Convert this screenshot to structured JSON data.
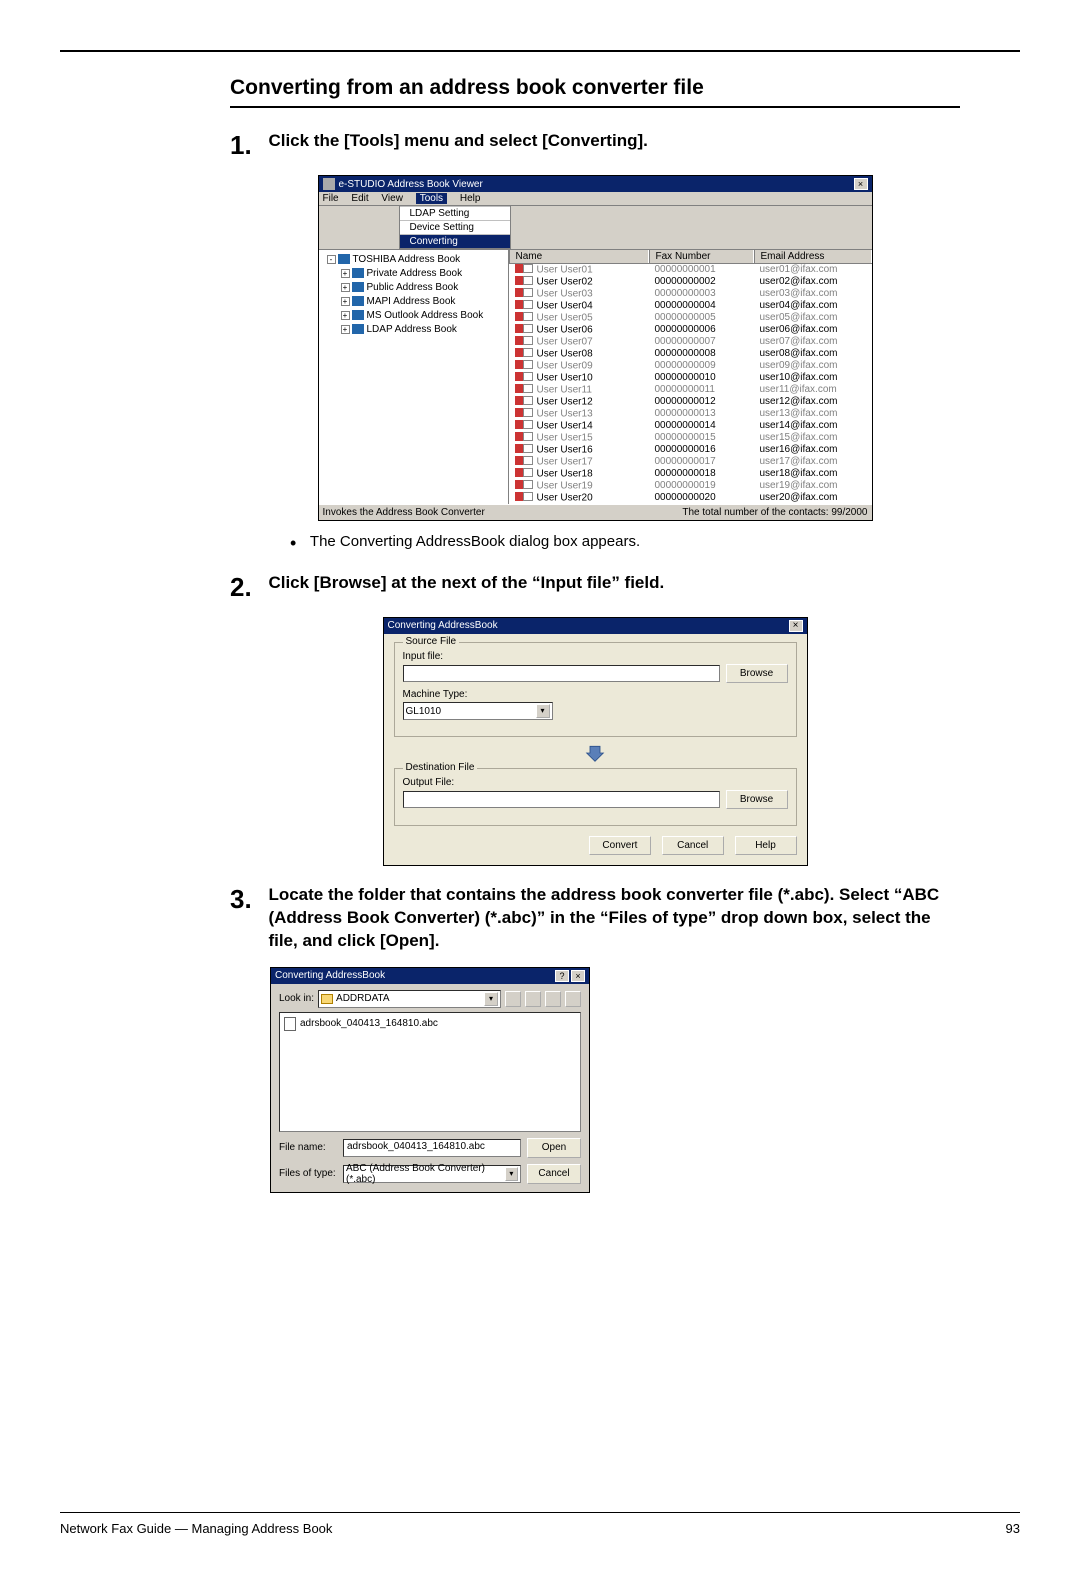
{
  "section_title": "Converting from an address book converter file",
  "steps": {
    "s1": {
      "num": "1.",
      "text": "Click the [Tools] menu and select [Converting]."
    },
    "s1_bullet": "The Converting AddressBook dialog box appears.",
    "s2": {
      "num": "2.",
      "text": "Click [Browse] at the next of the “Input file” field."
    },
    "s3": {
      "num": "3.",
      "text": "Locate the folder that contains the address book converter file (*.abc).  Select “ABC (Address Book Converter) (*.abc)” in the “Files of type” drop down box, select the file, and click [Open]."
    }
  },
  "shot1": {
    "title": "e-STUDIO Address Book Viewer",
    "close": "×",
    "menubar": {
      "file": "File",
      "edit": "Edit",
      "view": "View",
      "tools": "Tools",
      "help": "Help"
    },
    "tools_menu": {
      "ldap": "LDAP Setting",
      "device": "Device Setting",
      "converting": "Converting"
    },
    "tree": {
      "root": "TOSHIBA Address Book",
      "items": [
        "Private Address Book",
        "Public Address Book",
        "MAPI Address Book",
        "MS Outlook Address Book",
        "LDAP Address Book"
      ]
    },
    "headers": {
      "name": "Name",
      "fax": "Fax Number",
      "email": "Email Address"
    },
    "rows": [
      {
        "n": "User User01",
        "f": "00000000001",
        "e": "user01@ifax.com",
        "g": true
      },
      {
        "n": "User User02",
        "f": "00000000002",
        "e": "user02@ifax.com",
        "g": false
      },
      {
        "n": "User User03",
        "f": "00000000003",
        "e": "user03@ifax.com",
        "g": true
      },
      {
        "n": "User User04",
        "f": "00000000004",
        "e": "user04@ifax.com",
        "g": false
      },
      {
        "n": "User User05",
        "f": "00000000005",
        "e": "user05@ifax.com",
        "g": true
      },
      {
        "n": "User User06",
        "f": "00000000006",
        "e": "user06@ifax.com",
        "g": false
      },
      {
        "n": "User User07",
        "f": "00000000007",
        "e": "user07@ifax.com",
        "g": true
      },
      {
        "n": "User User08",
        "f": "00000000008",
        "e": "user08@ifax.com",
        "g": false
      },
      {
        "n": "User User09",
        "f": "00000000009",
        "e": "user09@ifax.com",
        "g": true
      },
      {
        "n": "User User10",
        "f": "00000000010",
        "e": "user10@ifax.com",
        "g": false
      },
      {
        "n": "User User11",
        "f": "00000000011",
        "e": "user11@ifax.com",
        "g": true
      },
      {
        "n": "User User12",
        "f": "00000000012",
        "e": "user12@ifax.com",
        "g": false
      },
      {
        "n": "User User13",
        "f": "00000000013",
        "e": "user13@ifax.com",
        "g": true
      },
      {
        "n": "User User14",
        "f": "00000000014",
        "e": "user14@ifax.com",
        "g": false
      },
      {
        "n": "User User15",
        "f": "00000000015",
        "e": "user15@ifax.com",
        "g": true
      },
      {
        "n": "User User16",
        "f": "00000000016",
        "e": "user16@ifax.com",
        "g": false
      },
      {
        "n": "User User17",
        "f": "00000000017",
        "e": "user17@ifax.com",
        "g": true
      },
      {
        "n": "User User18",
        "f": "00000000018",
        "e": "user18@ifax.com",
        "g": false
      },
      {
        "n": "User User19",
        "f": "00000000019",
        "e": "user19@ifax.com",
        "g": true
      },
      {
        "n": "User User20",
        "f": "00000000020",
        "e": "user20@ifax.com",
        "g": false
      }
    ],
    "status_left": "Invokes the Address Book Converter",
    "status_right": "The total number of the contacts: 99/2000"
  },
  "shot2": {
    "title": "Converting AddressBook",
    "close": "×",
    "src_group": "Source File",
    "input_label": "Input file:",
    "machine_label": "Machine Type:",
    "machine_value": "GL1010",
    "dest_group": "Destination File",
    "output_label": "Output File:",
    "browse": "Browse",
    "convert": "Convert",
    "cancel": "Cancel",
    "help": "Help"
  },
  "shot3": {
    "title": "Converting AddressBook",
    "q": "?",
    "close": "×",
    "lookin_label": "Look in:",
    "lookin_value": "ADDRDATA",
    "file_item": "adrsbook_040413_164810.abc",
    "filename_label": "File name:",
    "filename_value": "adrsbook_040413_164810.abc",
    "filetype_label": "Files of type:",
    "filetype_value": "ABC (Address Book Converter) (*.abc)",
    "open": "Open",
    "cancel": "Cancel",
    "dd": "▾"
  },
  "footer": {
    "left": "Network Fax Guide — Managing Address Book",
    "right": "93"
  }
}
